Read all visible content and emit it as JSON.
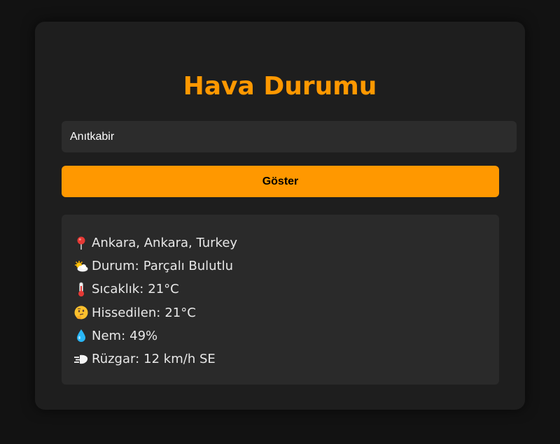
{
  "app": {
    "title": "Hava Durumu"
  },
  "search": {
    "value": "Anıtkabir",
    "button_label": "Göster"
  },
  "result": {
    "location": "Ankara, Ankara, Turkey",
    "condition_label": "Durum:",
    "condition_value": "Parçalı Bulutlu",
    "temperature_label": "Sıcaklık:",
    "temperature_value": "21°C",
    "feels_like_label": "Hissedilen:",
    "feels_like_value": "21°C",
    "humidity_label": "Nem:",
    "humidity_value": "49%",
    "wind_label": "Rüzgar:",
    "wind_value": "12 km/h SE"
  },
  "icons": {
    "location": "pushpin-icon",
    "condition": "sun-behind-cloud-icon",
    "temperature": "thermometer-icon",
    "feels_like": "thinking-face-icon",
    "humidity": "droplet-icon",
    "wind": "wind-icon"
  },
  "colors": {
    "background": "#121212",
    "card": "#1e1e1e",
    "accent": "#ff9800",
    "panel": "#2a2a2a",
    "input": "#2c2c2c",
    "text": "#e8e8e8"
  }
}
